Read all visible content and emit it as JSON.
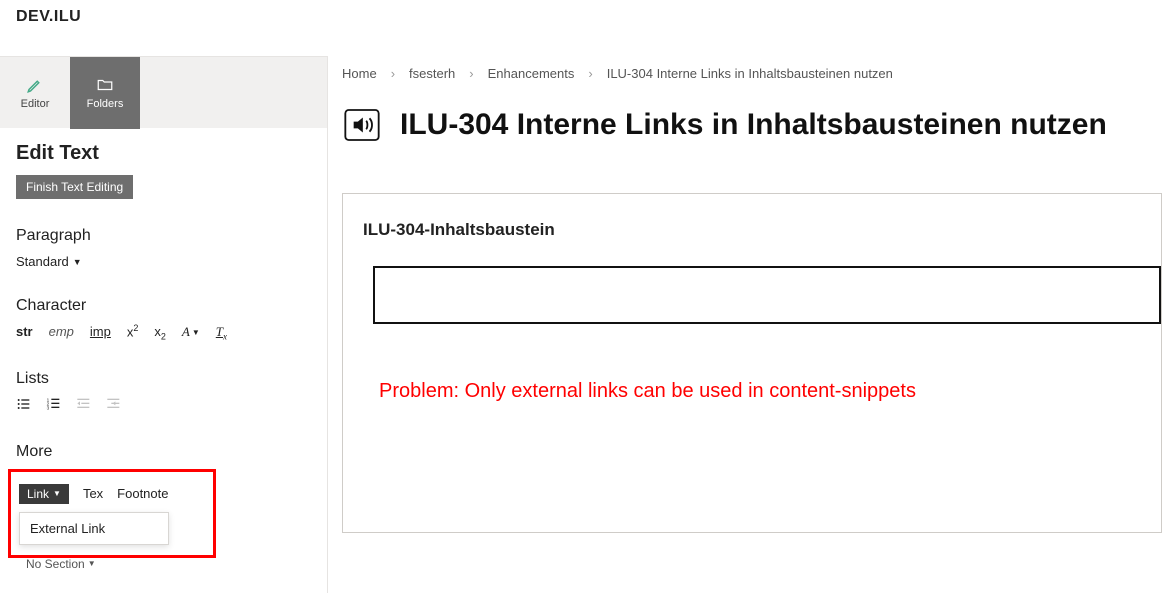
{
  "brand": "DEV.ILU",
  "modeTabs": {
    "editor": "Editor",
    "folders": "Folders"
  },
  "editor": {
    "title": "Edit Text",
    "finishButton": "Finish Text Editing",
    "paragraphLabel": "Paragraph",
    "paragraphSelect": "Standard",
    "characterLabel": "Character",
    "charButtons": {
      "str": "str",
      "emp": "emp",
      "imp": "imp",
      "sup": "x",
      "sub": "x",
      "afmt": "A",
      "tx": "T"
    },
    "listsLabel": "Lists",
    "moreLabel": "More",
    "moreRow": {
      "link": "Link",
      "tex": "Tex",
      "footnote": "Footnote"
    },
    "linkDropdown": "External Link",
    "noSection": "No Section"
  },
  "breadcrumbs": [
    "Home",
    "fsesterh",
    "Enhancements",
    "ILU-304 Interne Links in Inhaltsbausteinen nutzen"
  ],
  "pageTitle": "ILU-304 Interne Links in Inhaltsbausteinen nutzen",
  "card": {
    "title": "ILU-304-Inhaltsbaustein"
  },
  "annotation": "Problem: Only external links can be used in content-snippets"
}
